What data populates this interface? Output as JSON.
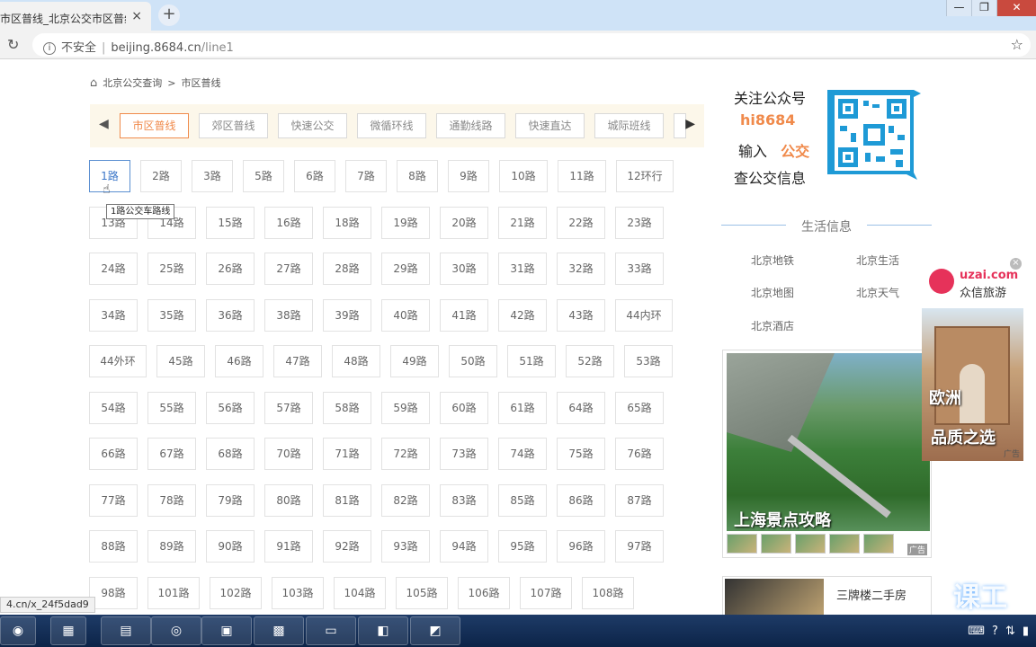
{
  "browser": {
    "tab_title": "市区普线_北京公交市区普线",
    "tab_close": "×",
    "new_tab": "+",
    "win_min": "—",
    "win_max": "❐",
    "win_close": "✕",
    "security": "不安全",
    "url_host": "beijing.8684.cn",
    "url_path": "/line1",
    "status_url": "4.cn/x_24f5dad9"
  },
  "breadcrumb": {
    "home": "北京公交查询",
    "arrow": ">",
    "current": "市区普线"
  },
  "categories": [
    "市区普线",
    "郊区普线",
    "快速公交",
    "微循环线",
    "通勤线路",
    "快速直达",
    "城际班线"
  ],
  "tooltip": "1路公交车路线",
  "routes": [
    [
      "1路",
      "2路",
      "3路",
      "5路",
      "6路",
      "7路",
      "8路",
      "9路",
      "10路",
      "11路",
      "12环行"
    ],
    [
      "13路",
      "14路",
      "15路",
      "16路",
      "18路",
      "19路",
      "20路",
      "21路",
      "22路",
      "23路"
    ],
    [
      "24路",
      "25路",
      "26路",
      "27路",
      "28路",
      "29路",
      "30路",
      "31路",
      "32路",
      "33路"
    ],
    [
      "34路",
      "35路",
      "36路",
      "38路",
      "39路",
      "40路",
      "41路",
      "42路",
      "43路",
      "44内环"
    ],
    [
      "44外环",
      "45路",
      "46路",
      "47路",
      "48路",
      "49路",
      "50路",
      "51路",
      "52路",
      "53路"
    ],
    [
      "54路",
      "55路",
      "56路",
      "57路",
      "58路",
      "59路",
      "60路",
      "61路",
      "64路",
      "65路"
    ],
    [
      "66路",
      "67路",
      "68路",
      "70路",
      "71路",
      "72路",
      "73路",
      "74路",
      "75路",
      "76路"
    ],
    [
      "77路",
      "78路",
      "79路",
      "80路",
      "81路",
      "82路",
      "83路",
      "85路",
      "86路",
      "87路"
    ],
    [
      "88路",
      "89路",
      "90路",
      "91路",
      "92路",
      "93路",
      "94路",
      "95路",
      "96路",
      "97路"
    ],
    [
      "98路",
      "101路",
      "102路",
      "103路",
      "104路",
      "105路",
      "106路",
      "107路",
      "108路"
    ]
  ],
  "wechat": {
    "line1": "关注公众号",
    "brand": "hi8684",
    "line3a": "输入",
    "line3b": "公交",
    "line4": "查公交信息"
  },
  "life": {
    "title": "生活信息",
    "links": [
      "北京地铁",
      "北京生活",
      "北京地图",
      "北京天气",
      "北京酒店"
    ]
  },
  "ad_main": {
    "caption": "上海景点攻略",
    "tag": "广告"
  },
  "news": {
    "text": "三牌楼二手房"
  },
  "float_ad": {
    "brand": "uzai.com",
    "sub": "众信旅游",
    "text1": "欧洲",
    "text2": "品质之选",
    "tag": "广告",
    "close": "×"
  },
  "watermark": "课工"
}
